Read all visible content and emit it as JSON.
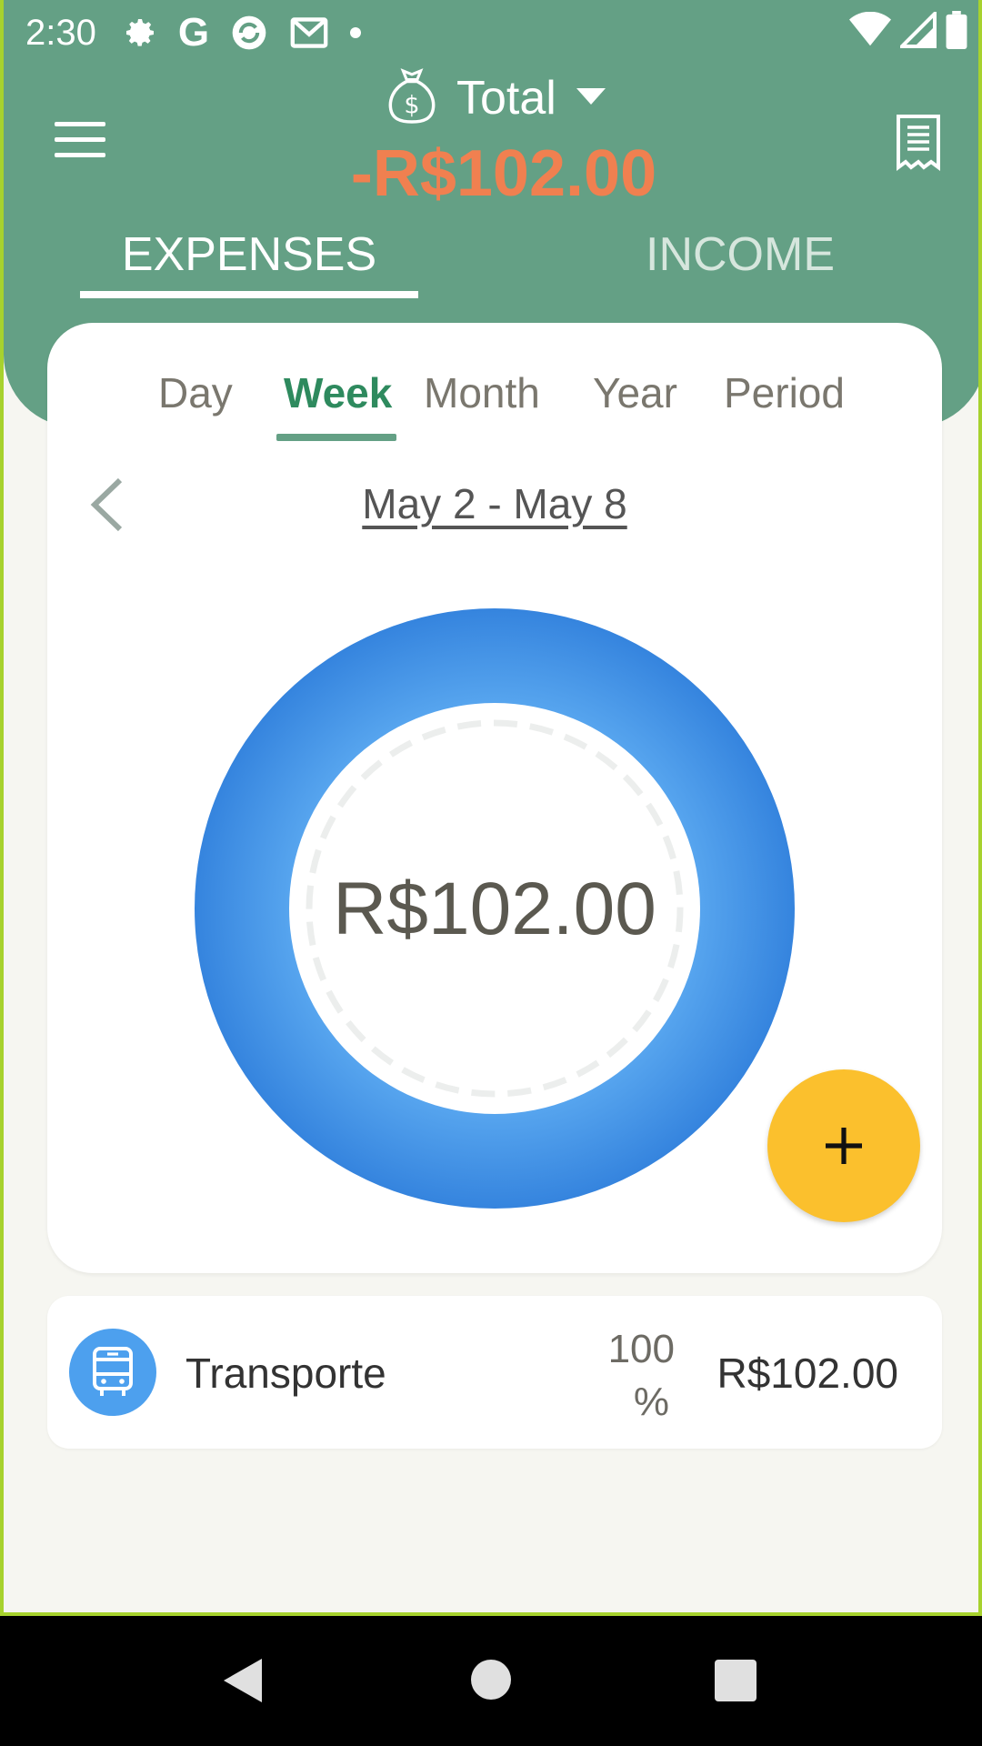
{
  "status_bar": {
    "time": "2:30",
    "icons": [
      "settings-icon",
      "google-icon",
      "sync-icon",
      "mail-icon",
      "dot-icon"
    ],
    "right_icons": [
      "wifi-icon",
      "signal-icon",
      "battery-icon"
    ]
  },
  "header": {
    "account_label": "Total",
    "total_amount": "-R$102.00",
    "total_color": "#f08050",
    "tabs": [
      {
        "label": "EXPENSES",
        "active": true
      },
      {
        "label": "INCOME",
        "active": false
      }
    ]
  },
  "period": {
    "tabs": [
      "Day",
      "Week",
      "Month",
      "Year",
      "Period"
    ],
    "active": "Week",
    "date_range": "May 2 - May 8"
  },
  "chart_data": {
    "type": "pie",
    "categories": [
      "Transporte"
    ],
    "values": [
      102.0
    ],
    "center_label": "R$102.00",
    "colors": [
      "#3f8fe3"
    ]
  },
  "categories": [
    {
      "name": "Transporte",
      "percent_num": "100",
      "percent_sign": "%",
      "amount": "R$102.00",
      "icon": "bus-icon",
      "color": "#4da0ee"
    }
  ],
  "fab": {
    "icon": "plus-icon",
    "color": "#fbc02d"
  },
  "colors": {
    "header": "#64a085",
    "accent": "#2e8a5e",
    "background": "#f6f6f1"
  }
}
